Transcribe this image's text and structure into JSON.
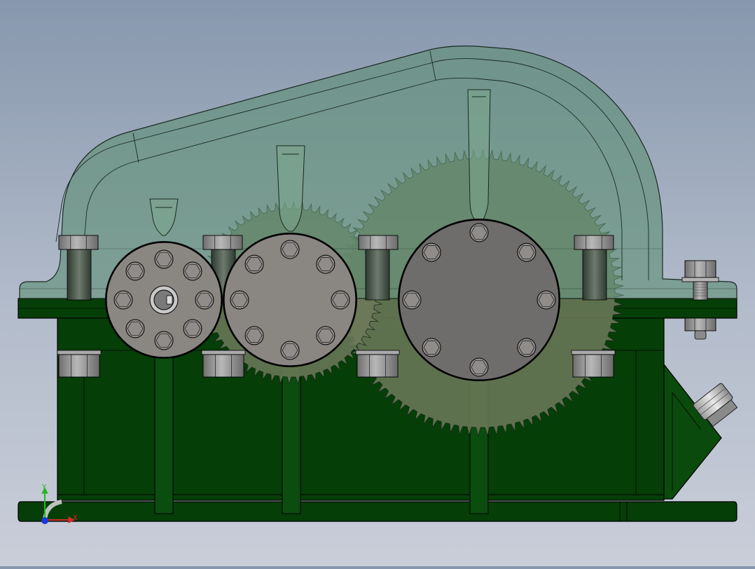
{
  "colors": {
    "background_top": "#8797ad",
    "background_bottom": "#c9ced9",
    "housing_green": "#053e07",
    "housing_rib_green": "#0a4d0f",
    "cover_translucent": "#5e8e74",
    "gear_olive": "#6f7a5a",
    "bearing_cap_grey": "#8a8682",
    "bolt_grey": "#8f8f8f",
    "edge_line": "#000000"
  },
  "triad": {
    "x_label": "X",
    "y_label": "Y",
    "x_color": "#d42a2a",
    "y_color": "#2ab42a",
    "z_color": "#1a3ad8"
  }
}
